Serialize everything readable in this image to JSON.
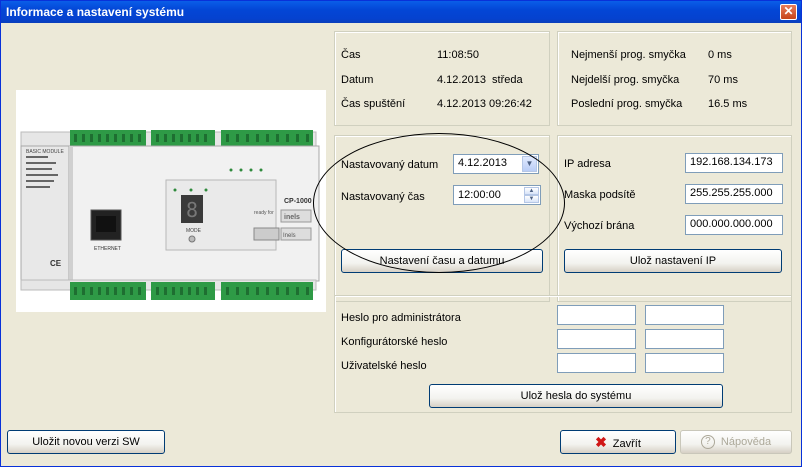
{
  "window": {
    "title": "Informace a nastavení systému",
    "close_glyph": "✕"
  },
  "status": {
    "time_label": "Čas",
    "time_value": "11:08:50",
    "date_label": "Datum",
    "date_value": "4.12.2013  středa",
    "start_label": "Čas spuštění",
    "start_value": "4.12.2013 09:26:42"
  },
  "loop": {
    "min_label": "Nejmenší prog. smyčka",
    "min_value": "0 ms",
    "max_label": "Nejdelší prog. smyčka",
    "max_value": "70 ms",
    "last_label": "Poslední prog. smyčka",
    "last_value": "16.5 ms"
  },
  "datetime": {
    "date_label": "Nastavovaný datum",
    "date_value": "4.12.2013",
    "time_label": "Nastavovaný čas",
    "time_value": "12:00:00",
    "set_button": "Nastavení času a datumu"
  },
  "network": {
    "ip_label": "IP adresa",
    "ip_value": "192.168.134.173",
    "mask_label": "Maska podsítě",
    "mask_value": "255.255.255.000",
    "gateway_label": "Výchozí brána",
    "gateway_value": "000.000.000.000",
    "save_button": "Ulož nastavení IP"
  },
  "passwords": {
    "admin_label": "Heslo pro administrátora",
    "config_label": "Konfigurátorské heslo",
    "user_label": "Uživatelské heslo",
    "save_button": "Ulož hesla do systému"
  },
  "device": {
    "digit": "8",
    "mode_label": "MODE",
    "brand": "inels",
    "model": "CP-1000",
    "small_brand": "Inels",
    "port_label": "ETHERNET",
    "module_text": "BASIC MODULE",
    "ready_label": "ready for"
  },
  "footer": {
    "update_button": "Uložit novou verzi SW",
    "close_button": "Zavřít",
    "help_button": "Nápověda",
    "close_icon": "red-x-icon",
    "help_icon": "question-icon"
  },
  "colors": {
    "title_bar": "#0346d6",
    "terminal_green": "#2e9a46",
    "close_icon_red": "#d01616"
  }
}
